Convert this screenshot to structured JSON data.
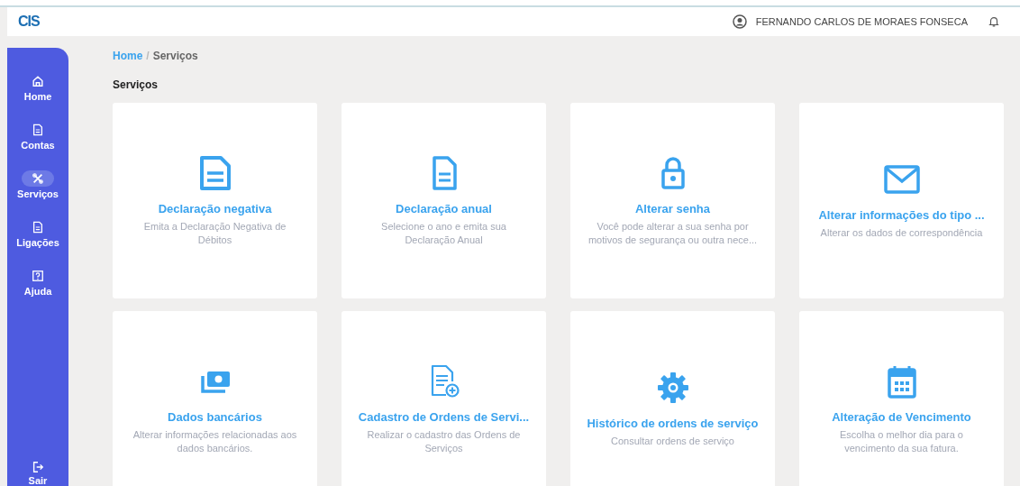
{
  "header": {
    "logo": "CIS",
    "user_name": "FERNANDO CARLOS DE MORAES FONSECA"
  },
  "sidebar": {
    "items": [
      {
        "label": "Home",
        "kind": "home",
        "selected": false
      },
      {
        "label": "Contas",
        "kind": "doc",
        "selected": false
      },
      {
        "label": "Serviços",
        "kind": "tools",
        "selected": true
      },
      {
        "label": "Ligações",
        "kind": "doc",
        "selected": false
      },
      {
        "label": "Ajuda",
        "kind": "help",
        "selected": false
      }
    ],
    "logout": {
      "label": "Sair"
    }
  },
  "breadcrumb": {
    "items": [
      "Home",
      "Serviços"
    ],
    "separator": "/"
  },
  "page_title": "Serviços",
  "cards": [
    {
      "kind": "doc-lines",
      "title": "Declaração negativa",
      "description": "Emita a Declaração Negativa de Débitos"
    },
    {
      "kind": "doc",
      "title": "Declaração anual",
      "description": "Selecione o ano e emita sua Declaração Anual"
    },
    {
      "kind": "lock",
      "title": "Alterar senha",
      "description": "Você pode alterar a sua senha por motivos de segurança ou outra nece..."
    },
    {
      "kind": "mail",
      "title": "Alterar informações do tipo ...",
      "description": "Alterar os dados de correspondência"
    },
    {
      "kind": "money",
      "title": "Dados bancários",
      "description": "Alterar informações relacionadas aos dados bancários."
    },
    {
      "kind": "doc-plus",
      "title": "Cadastro de Ordens de Servi...",
      "description": "Realizar o cadastro das Ordens de Serviços"
    },
    {
      "kind": "gear",
      "title": "Histórico de ordens de serviço",
      "description": "Consultar ordens de serviço"
    },
    {
      "kind": "calendar",
      "title": "Alteração de Vencimento",
      "description": "Escolha o melhor dia para o vencimento da sua fatura."
    }
  ]
}
